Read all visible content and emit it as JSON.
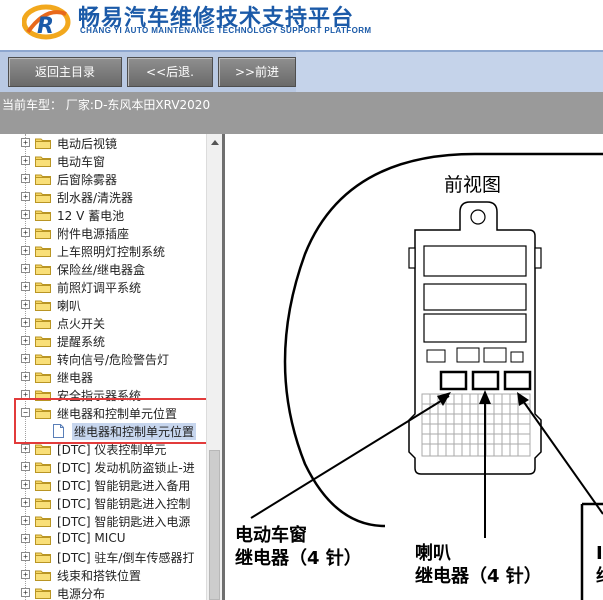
{
  "header": {
    "title_cn": "畅易汽车维修技术支持平台",
    "title_en": "CHANG YI AUTO MAINTENANCE TECHNOLOGY SUPPORT PLATFORM",
    "brand_color": "#1b5aa8"
  },
  "toolbar": {
    "home_label": "返回主目录",
    "back_label": "<<后退.",
    "forward_label": ">>前进"
  },
  "vehicle": {
    "text": "当前车型： 厂家:D-东风本田XRV2020"
  },
  "tree": {
    "items": [
      {
        "label": "电动后视镜",
        "expander": "+"
      },
      {
        "label": "电动车窗",
        "expander": "+"
      },
      {
        "label": "后窗除雾器",
        "expander": "+"
      },
      {
        "label": "刮水器/清洗器",
        "expander": "+"
      },
      {
        "label": "12 V 蓄电池",
        "expander": "+"
      },
      {
        "label": "附件电源插座",
        "expander": "+"
      },
      {
        "label": "上车照明灯控制系统",
        "expander": "+"
      },
      {
        "label": "保险丝/继电器盒",
        "expander": "+"
      },
      {
        "label": "前照灯调平系统",
        "expander": "+"
      },
      {
        "label": "喇叭",
        "expander": "+"
      },
      {
        "label": "点火开关",
        "expander": "+"
      },
      {
        "label": "提醒系统",
        "expander": "+"
      },
      {
        "label": "转向信号/危险警告灯",
        "expander": "+"
      },
      {
        "label": "继电器",
        "expander": "+"
      },
      {
        "label": "安全指示器系统",
        "expander": "+"
      },
      {
        "label": "继电器和控制单元位置",
        "expander": "−"
      },
      {
        "label": "继电器和控制单元位置",
        "expander": ""
      },
      {
        "label": "[DTC] 仪表控制单元",
        "expander": "+"
      },
      {
        "label": "[DTC] 发动机防盗锁止-进",
        "expander": "+"
      },
      {
        "label": "[DTC] 智能钥匙进入备用",
        "expander": "+"
      },
      {
        "label": "[DTC] 智能钥匙进入控制",
        "expander": "+"
      },
      {
        "label": "[DTC] 智能钥匙进入电源",
        "expander": "+"
      },
      {
        "label": "[DTC] MICU",
        "expander": "+"
      },
      {
        "label": "[DTC] 驻车/倒车传感器打",
        "expander": "+"
      },
      {
        "label": "线束和搭铁位置",
        "expander": "+"
      },
      {
        "label": "电源分布",
        "expander": "+"
      }
    ],
    "highlight_color": "#e23b3b",
    "selected_color": "#c7d6ee"
  },
  "diagram": {
    "view_label": "前视图",
    "callout_window_line1": "电动车窗",
    "callout_window_line2": "继电器（4 针）",
    "callout_horn_line1": "喇叭",
    "callout_horn_line2": "继电器（4 针）",
    "callout_right_line1": "I",
    "callout_right_line2": "继"
  }
}
